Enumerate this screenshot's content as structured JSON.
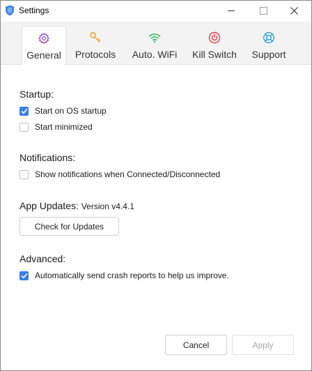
{
  "window": {
    "title": "Settings"
  },
  "tabs": [
    {
      "label": "General",
      "icon": "gear-icon",
      "color": "#9b4fd0",
      "active": true
    },
    {
      "label": "Protocols",
      "icon": "key-icon",
      "color": "#f0a030",
      "active": false
    },
    {
      "label": "Auto. WiFi",
      "icon": "wifi-icon",
      "color": "#2fb85a",
      "active": false
    },
    {
      "label": "Kill Switch",
      "icon": "power-icon",
      "color": "#e0404a",
      "active": false
    },
    {
      "label": "Support",
      "icon": "lifebuoy-icon",
      "color": "#2aa6d8",
      "active": false
    }
  ],
  "startup": {
    "title": "Startup:",
    "start_on_os": {
      "label": "Start on OS startup",
      "checked": true
    },
    "start_minimized": {
      "label": "Start minimized",
      "checked": false
    }
  },
  "notifications": {
    "title": "Notifications:",
    "show_notifications": {
      "label": "Show notifications when Connected/Disconnected",
      "checked": false
    }
  },
  "updates": {
    "title": "App Updates:",
    "version": "Version v4.4.1",
    "check_button": "Check for Updates"
  },
  "advanced": {
    "title": "Advanced:",
    "crash_reports": {
      "label": "Automatically send crash reports to help us improve.",
      "checked": true
    }
  },
  "footer": {
    "cancel": "Cancel",
    "apply": "Apply"
  },
  "colors": {
    "accent": "#3a7ee6"
  }
}
